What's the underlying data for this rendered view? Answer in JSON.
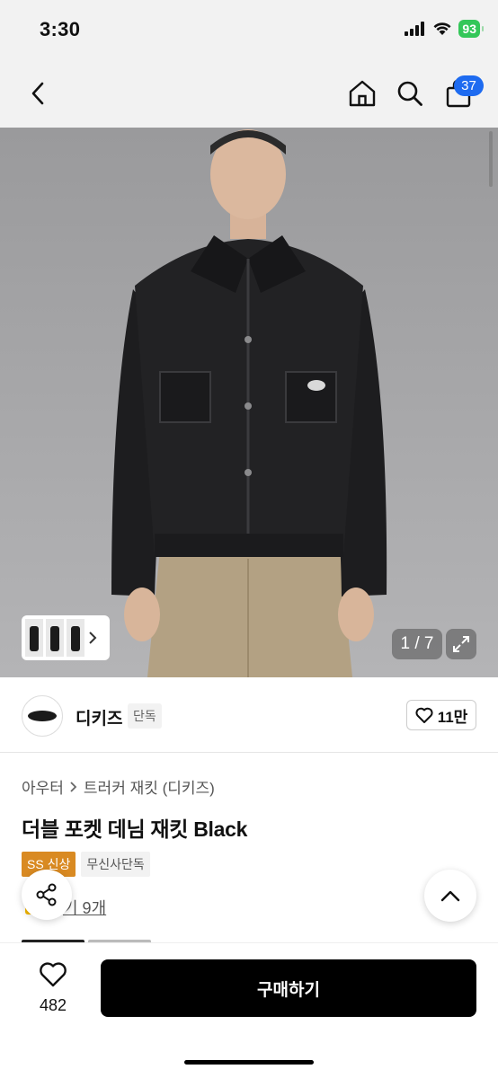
{
  "status_bar": {
    "time": "3:30",
    "battery": "93"
  },
  "nav": {
    "cart_count": "37",
    "icons": [
      "back-icon",
      "home-icon",
      "search-icon",
      "cart-icon"
    ]
  },
  "gallery": {
    "counter": "1 / 7",
    "thumb_count": 3,
    "icons": [
      "chevron-right-icon",
      "expand-icon"
    ]
  },
  "brand": {
    "name": "디키즈",
    "exclusive_tag": "단독",
    "logo_text": "Dickies",
    "like_count": "11만"
  },
  "product": {
    "breadcrumb": [
      "아우터",
      "트러커 재킷 (디키즈)"
    ],
    "title": "더블 포켓 데님 재킷 Black",
    "tags": [
      "SS 신상",
      "무신사단독"
    ],
    "review_text": "기 9개"
  },
  "bottom_bar": {
    "wish_count": "482",
    "buy_label": "구매하기"
  },
  "colors": {
    "accent": "#1e6bf0",
    "battery": "#34c759",
    "new_tag": "#d98a22",
    "buy_button": "#000000"
  }
}
